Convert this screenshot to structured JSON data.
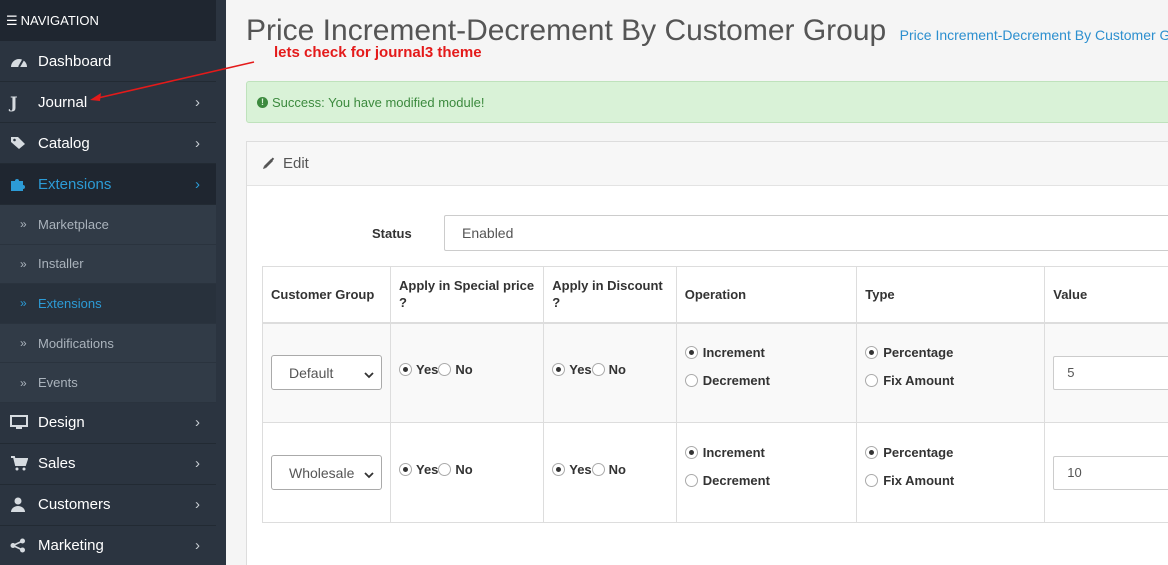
{
  "sidebar": {
    "header": "NAVIGATION",
    "items": [
      {
        "label": "Dashboard",
        "icon": "dashboard-icon"
      },
      {
        "label": "Journal",
        "icon": "journal-icon"
      },
      {
        "label": "Catalog",
        "icon": "tags-icon"
      },
      {
        "label": "Extensions",
        "icon": "puzzle-icon"
      },
      {
        "label": "Design",
        "icon": "monitor-icon"
      },
      {
        "label": "Sales",
        "icon": "cart-icon"
      },
      {
        "label": "Customers",
        "icon": "user-icon"
      },
      {
        "label": "Marketing",
        "icon": "share-icon"
      }
    ],
    "submenu": [
      {
        "label": "Marketplace"
      },
      {
        "label": "Installer"
      },
      {
        "label": "Extensions"
      },
      {
        "label": "Modifications"
      },
      {
        "label": "Events"
      }
    ]
  },
  "header": {
    "title": "Price Increment-Decrement By Customer Group",
    "breadcrumb": "Price Increment-Decrement By Customer Group"
  },
  "annotation": "lets check for journal3 theme",
  "alert": {
    "text": "Success: You have modified module!"
  },
  "panel": {
    "title": "Edit"
  },
  "status": {
    "label": "Status",
    "value": "Enabled"
  },
  "table": {
    "headers": {
      "group": "Customer Group",
      "special": "Apply in Special price ?",
      "discount": "Apply in Discount ?",
      "operation": "Operation",
      "type": "Type",
      "value": "Value"
    },
    "yes": "Yes",
    "no": "No",
    "increment": "Increment",
    "decrement": "Decrement",
    "percentage": "Percentage",
    "fixed": "Fix Amount",
    "rows": [
      {
        "group": "Default",
        "value": "5"
      },
      {
        "group": "Wholesale",
        "value": "10"
      }
    ]
  },
  "colors": {
    "accent": "#2c9bd6",
    "sidebar": "#2b3440",
    "annotation": "#e41a1a",
    "success_bg": "#d9f2d7"
  }
}
